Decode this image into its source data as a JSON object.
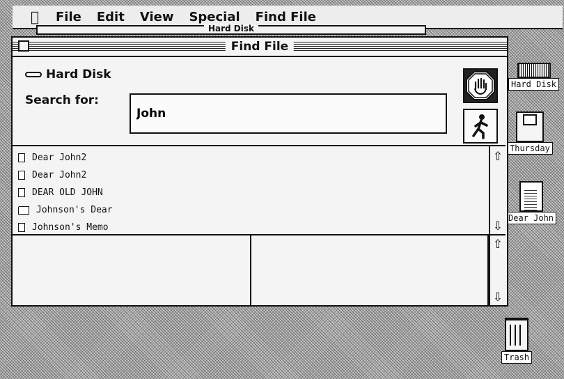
{
  "menubar": {
    "apple": "",
    "items": [
      "File",
      "Edit",
      "View",
      "Special",
      "Find File"
    ]
  },
  "background_window": {
    "title": "Hard Disk"
  },
  "desktop": {
    "icons": [
      {
        "label": "Hard Disk",
        "icon": "hard-disk-icon"
      },
      {
        "label": "Thursday",
        "icon": "floppy-disk-icon"
      },
      {
        "label": "Dear John",
        "icon": "document-icon"
      },
      {
        "label": "Trash",
        "icon": "trash-icon"
      }
    ]
  },
  "window": {
    "title": "Find File",
    "volume": "Hard Disk",
    "search_label": "Search for:",
    "search_value": "John",
    "results": [
      {
        "name": "Dear John2",
        "icon": "document-icon"
      },
      {
        "name": "Dear John2",
        "icon": "document-icon"
      },
      {
        "name": "DEAR OLD JOHN",
        "icon": "document-icon"
      },
      {
        "name": "Johnson's Dear",
        "icon": "folder-icon"
      },
      {
        "name": "Johnson's Memo",
        "icon": "document-icon"
      }
    ]
  }
}
